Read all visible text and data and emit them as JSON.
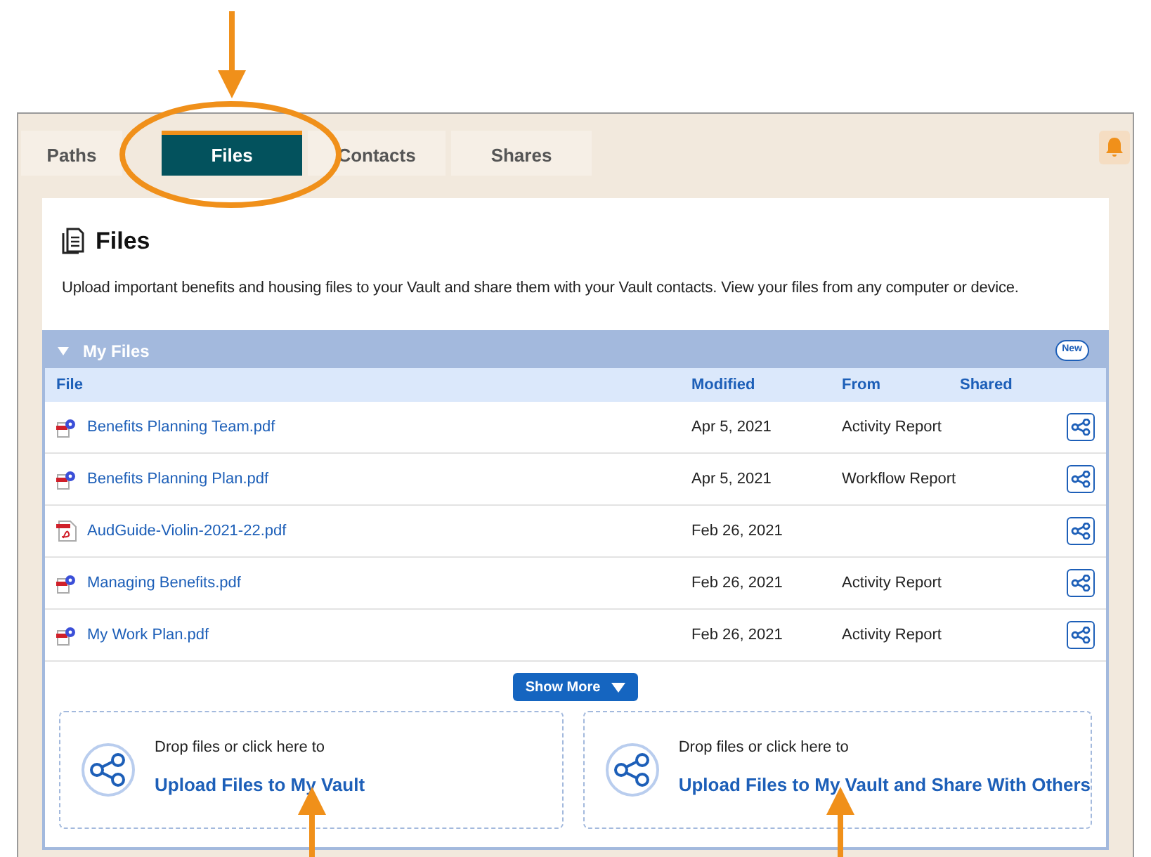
{
  "tabs": [
    {
      "label": "Paths",
      "selected": false
    },
    {
      "label": "Files",
      "selected": true
    },
    {
      "label": "Contacts",
      "selected": false
    },
    {
      "label": "Shares",
      "selected": false
    }
  ],
  "page": {
    "title": "Files",
    "description": "Upload important benefits and housing files to your Vault and share them with your Vault contacts. View your files from any computer or device."
  },
  "section": {
    "title": "My Files",
    "expanded": true,
    "badge": "New"
  },
  "table": {
    "columns": [
      "File",
      "Modified",
      "From",
      "Shared"
    ],
    "rows": [
      {
        "kind": "report",
        "file": "Benefits Planning Team.pdf",
        "modified": "Apr 5, 2021",
        "from": "Activity Report"
      },
      {
        "kind": "report",
        "file": "Benefits Planning Plan.pdf",
        "modified": "Apr 5, 2021",
        "from": "Workflow Report"
      },
      {
        "kind": "pdf",
        "file": "AudGuide-Violin-2021-22.pdf",
        "modified": "Feb 26, 2021"
      },
      {
        "kind": "report",
        "file": "Managing Benefits.pdf",
        "modified": "Feb 26, 2021",
        "from": "Activity Report"
      },
      {
        "kind": "report",
        "file": "My Work Plan.pdf",
        "modified": "Feb 26, 2021",
        "from": "Activity Report"
      }
    ]
  },
  "show_more": "Show More",
  "upload_zones": [
    {
      "hint": "Drop files or click here to",
      "action": "Upload Files to My Vault"
    },
    {
      "hint": "Drop files or click here to",
      "action": "Upload Files to My Vault and Share With Others"
    }
  ]
}
